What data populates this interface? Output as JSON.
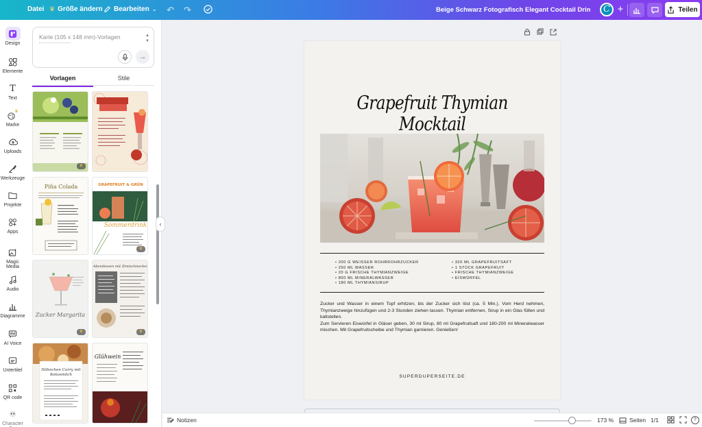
{
  "topbar": {
    "file_label": "Datei",
    "resize_label": "Größe ändern",
    "edit_label": "Bearbeiten",
    "doc_title": "Beige Schwarz Fotografisch Elegant Cocktail Drink Rezept K...",
    "avatar_letter": "C",
    "share_label": "Teilen"
  },
  "rail": {
    "items": [
      {
        "label": "Design",
        "icon": "design-icon"
      },
      {
        "label": "Elemente",
        "icon": "elements-icon"
      },
      {
        "label": "Text",
        "icon": "text-icon"
      },
      {
        "label": "Marke",
        "icon": "brand-icon"
      },
      {
        "label": "Uploads",
        "icon": "upload-cloud-icon"
      },
      {
        "label": "Werkzeuge",
        "icon": "tools-icon"
      },
      {
        "label": "Projekte",
        "icon": "folder-icon"
      },
      {
        "label": "Apps",
        "icon": "apps-icon"
      },
      {
        "label": "Magic Media",
        "icon": "magic-media-icon"
      },
      {
        "label": "Audio",
        "icon": "audio-icon"
      },
      {
        "label": "Diagramme",
        "icon": "chart-icon"
      },
      {
        "label": "AI Voice",
        "icon": "ai-voice-icon"
      },
      {
        "label": "Untertitel",
        "icon": "subtitles-icon"
      },
      {
        "label": "QR code",
        "icon": "qr-code-icon"
      },
      {
        "label": "Character B...",
        "icon": "character-icon"
      }
    ]
  },
  "panel": {
    "search_placeholder": "Karte (105 x 148 mm)-Vorlagen",
    "tab_templates": "Vorlagen",
    "tab_styles": "Stile",
    "templates": [
      {
        "title": "GRÜNER POWER SMOOTHIE",
        "bg": "#f7f6ef",
        "accent": "#6b8e23"
      },
      {
        "title": "Berry Lemonade",
        "bg": "#f6ead9",
        "accent": "#c0392b"
      },
      {
        "title": "Piña Colada",
        "bg": "#fbfaf6",
        "accent": "#7a6a2f"
      },
      {
        "title": "GRAPEFRUIT & GRÜN",
        "bg": "#ffffff",
        "accent": "#e07b1c"
      },
      {
        "title": "Zucker Margarita",
        "bg": "#f1f1ef",
        "accent": "#888"
      },
      {
        "title": "Abendessen mit Zimtschnecken",
        "bg": "#f4f1ec",
        "accent": "#333"
      },
      {
        "title": "Hähnchen Curry mit Kokosmilch",
        "bg": "#f5f1ea",
        "accent": "#333"
      },
      {
        "title": "Glühwein",
        "bg": "#fbfaf7",
        "accent": "#222"
      }
    ]
  },
  "document": {
    "title": "Grapefruit Thymian Mocktail",
    "ingredients_left": [
      "200 G WEISSER ROHRROHRZUCKER",
      "250 ML WASSER",
      "20 G FRISCHE THYMIANZWEIGE",
      "800 ML MINERALWASSER",
      "180 ML THYMIANSIRUP"
    ],
    "ingredients_right": [
      "320 ML GRAPEFRUITSAFT",
      "1 STÜCK GRAPEFRUIT",
      "FRISCHE THYMIANZWEIGE",
      "EISWÜRFEL"
    ],
    "method_1": "Zucker und Wasser in einem Topf erhitzen, bis der Zucker sich löst (ca. 5 Min.). Vom Herd nehmen, Thymianzweige hinzufügen und 2-3 Stunden ziehen lassen. Thymian entfernen, Sirup in ein Glas füllen und kaltstellen.",
    "method_2": "Zum Servieren Eiswürfel in Gläser geben, 30 ml Sirup, 80 ml Grapefruitsaft und 180-200 ml Mineralwasser mischen. Mit Grapefruitscheibe und Thymian garnieren. Genießen!",
    "footer_url": "SUPERDUPERSEITE.DE"
  },
  "bottombar": {
    "notes_label": "Notizen",
    "zoom_value": "173 %",
    "zoom_fraction": 0.66,
    "pages_label": "Seiten",
    "page_count": "1/1"
  },
  "colors": {
    "accent_purple": "#7d2ae8",
    "topbar_start": "#18b6c9",
    "topbar_end": "#8a3cf0"
  }
}
